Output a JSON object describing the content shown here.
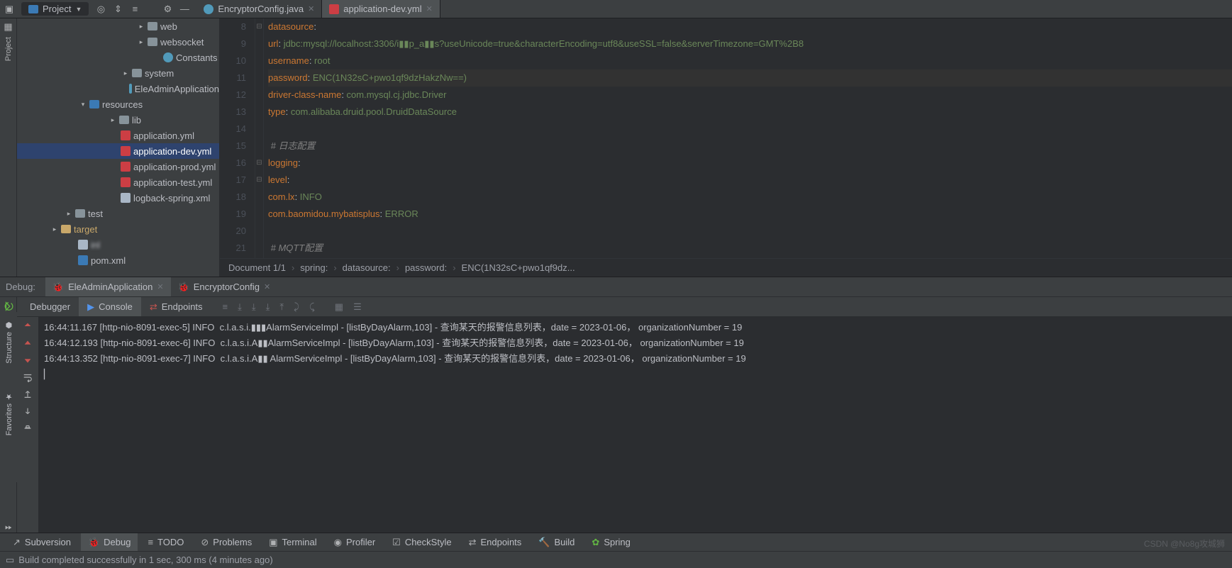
{
  "toolbar": {
    "project_label": "Project"
  },
  "tabs": [
    {
      "label": "EncryptorConfig.java",
      "icon": "java",
      "active": false
    },
    {
      "label": "application-dev.yml",
      "icon": "yml",
      "active": true
    }
  ],
  "tree": [
    {
      "pad": 170,
      "arrow": ">",
      "icon": "folder",
      "label": "web"
    },
    {
      "pad": 170,
      "arrow": ">",
      "icon": "folder",
      "label": "websocket"
    },
    {
      "pad": 192,
      "arrow": "",
      "icon": "class",
      "label": "Constants"
    },
    {
      "pad": 148,
      "arrow": ">",
      "icon": "folder",
      "label": "system"
    },
    {
      "pad": 152,
      "arrow": "",
      "icon": "class",
      "label": "EleAdminApplication"
    },
    {
      "pad": 88,
      "arrow": "v",
      "icon": "folder-blue",
      "label": "resources"
    },
    {
      "pad": 130,
      "arrow": ">",
      "icon": "folder",
      "label": "lib"
    },
    {
      "pad": 132,
      "arrow": "",
      "icon": "yml",
      "label": "application.yml"
    },
    {
      "pad": 132,
      "arrow": "",
      "icon": "yml",
      "label": "application-dev.yml",
      "sel": true
    },
    {
      "pad": 132,
      "arrow": "",
      "icon": "yml",
      "label": "application-prod.yml"
    },
    {
      "pad": 132,
      "arrow": "",
      "icon": "yml",
      "label": "application-test.yml"
    },
    {
      "pad": 132,
      "arrow": "",
      "icon": "xml",
      "label": "logback-spring.xml"
    },
    {
      "pad": 68,
      "arrow": ">",
      "icon": "folder",
      "label": "test"
    },
    {
      "pad": 48,
      "arrow": ">",
      "icon": "folder-gold",
      "label": "target",
      "gold": true
    },
    {
      "pad": 72,
      "arrow": "",
      "icon": "xml",
      "label": "inl",
      "blur": true
    },
    {
      "pad": 72,
      "arrow": "",
      "icon": "m",
      "label": "pom.xml"
    }
  ],
  "lines": [
    {
      "n": 8,
      "t": "   datasource:",
      "cls": [
        "k"
      ]
    },
    {
      "n": 9,
      "t": "     url: jdbc:mysql://localhost:3306/i▮▮p_a▮▮s?useUnicode=true&characterEncoding=utf8&useSSL=false&serverTimezone=GMT%2B8",
      "k": "url",
      "v": "jdbc:mysql://localhost:3306/i▮▮p_a▮▮s?useUnicode=true&characterEncoding=utf8&useSSL=false&serverTimezone=GMT%2B8"
    },
    {
      "n": 10,
      "t": "     username: root",
      "k": "username",
      "v": "root"
    },
    {
      "n": 11,
      "t": "     password: ENC(1N32sC+pwo1qf9dzHakzNw==)",
      "k": "password",
      "v": "ENC(1N32sC+pwo1qf9dzHakzNw==)",
      "hl": true
    },
    {
      "n": 12,
      "t": "     driver-class-name: com.mysql.cj.jdbc.Driver",
      "k": "driver-class-name",
      "v": "com.mysql.cj.jdbc.Driver"
    },
    {
      "n": 13,
      "t": "     type: com.alibaba.druid.pool.DruidDataSource",
      "k": "type",
      "v": "com.alibaba.druid.pool.DruidDataSource"
    },
    {
      "n": 14,
      "t": ""
    },
    {
      "n": 15,
      "t": " # 日志配置",
      "comment": true
    },
    {
      "n": 16,
      "t": " logging:",
      "k": "logging"
    },
    {
      "n": 17,
      "t": "   level:",
      "k": "level"
    },
    {
      "n": 18,
      "t": "     com.lx: INFO",
      "k": "com.lx",
      "v": "INFO"
    },
    {
      "n": 19,
      "t": "     com.baomidou.mybatisplus: ERROR",
      "k": "com.baomidou.mybatisplus",
      "v": "ERROR"
    },
    {
      "n": 20,
      "t": ""
    },
    {
      "n": 21,
      "t": " # MQTT配置",
      "comment": true
    }
  ],
  "breadcrumb": [
    "Document 1/1",
    "spring:",
    "datasource:",
    "password:",
    "ENC(1N32sC+pwo1qf9dz..."
  ],
  "debug": {
    "label": "Debug:",
    "run_tabs": [
      {
        "label": "EleAdminApplication",
        "sel": true
      },
      {
        "label": "EncryptorConfig",
        "sel": false
      }
    ],
    "inner_tabs": [
      {
        "label": "Debugger",
        "sel": false
      },
      {
        "label": "Console",
        "sel": true,
        "icon": "play"
      },
      {
        "label": "Endpoints",
        "sel": false,
        "icon": "ep"
      }
    ],
    "console": [
      "16:44:11.167 [http-nio-8091-exec-5] INFO  c.l.a.s.i.▮▮▮AlarmServiceImpl - [listByDayAlarm,103] - 查询某天的报警信息列表，date = 2023-01-06， organizationNumber = 19",
      "16:44:12.193 [http-nio-8091-exec-6] INFO  c.l.a.s.i.A▮▮AlarmServiceImpl - [listByDayAlarm,103] - 查询某天的报警信息列表，date = 2023-01-06， organizationNumber = 19",
      "16:44:13.352 [http-nio-8091-exec-7] INFO  c.l.a.s.i.A▮▮ AlarmServiceImpl - [listByDayAlarm,103] - 查询某天的报警信息列表，date = 2023-01-06， organizationNumber = 19"
    ]
  },
  "bottom": [
    {
      "icon": "vcs",
      "label": "Subversion"
    },
    {
      "icon": "bug",
      "label": "Debug",
      "sel": true
    },
    {
      "icon": "todo",
      "label": "TODO"
    },
    {
      "icon": "prob",
      "label": "Problems"
    },
    {
      "icon": "term",
      "label": "Terminal"
    },
    {
      "icon": "prof",
      "label": "Profiler"
    },
    {
      "icon": "chk",
      "label": "CheckStyle"
    },
    {
      "icon": "ep",
      "label": "Endpoints"
    },
    {
      "icon": "build",
      "label": "Build"
    },
    {
      "icon": "spring",
      "label": "Spring"
    }
  ],
  "status": "Build completed successfully in 1 sec, 300 ms (4 minutes ago)",
  "watermark": "CSDN @No8g攻城狮"
}
